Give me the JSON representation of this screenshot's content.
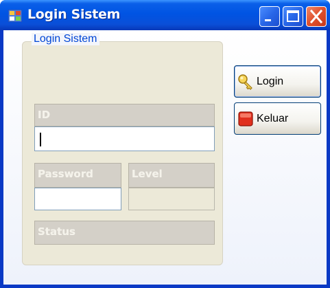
{
  "window": {
    "title": "Login Sistem"
  },
  "group": {
    "title": "Login Sistem"
  },
  "fields": {
    "id_label": "ID",
    "id_value": "",
    "password_label": "Password",
    "password_value": "",
    "level_label": "Level",
    "level_value": "",
    "status_label": "Status"
  },
  "buttons": {
    "login": "Login",
    "exit": "Keluar"
  },
  "colors": {
    "title_bar": "#0054e3",
    "group_title": "#0046d5",
    "close_button": "#e0502c"
  },
  "icons": {
    "app": "app-window-icon",
    "login": "key-icon",
    "exit": "stop-icon"
  }
}
